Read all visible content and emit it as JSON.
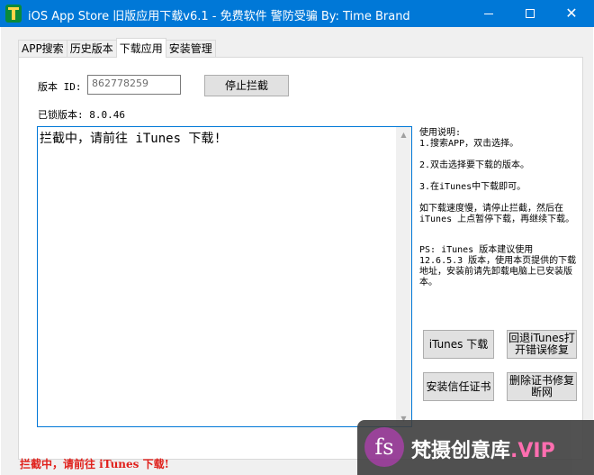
{
  "window": {
    "title": "iOS App Store 旧版应用下载v6.1 - 免费软件 警防受骗 By: Time Brand",
    "controls": {
      "minimize": "—",
      "maximize": "□",
      "close": "✕"
    }
  },
  "tabs": [
    {
      "label": "APP搜索",
      "active": false
    },
    {
      "label": "历史版本",
      "active": false
    },
    {
      "label": "下载应用",
      "active": true
    },
    {
      "label": "安装管理",
      "active": false
    }
  ],
  "download": {
    "version_label": "版本 ID:",
    "version_id_value": "862778259",
    "stop_button": "停止拦截",
    "locked_version": "已锁版本: 8.0.46",
    "log_text": "拦截中，请前往 iTunes 下载!"
  },
  "help": {
    "title": "使用说明:",
    "step1": "1.搜索APP，双击选择。",
    "step2": "2.双击选择要下载的版本。",
    "step3": "3.在iTunes中下载即可。",
    "tip": "如下载速度慢，请停止拦截，然后在 iTunes 上点暂停下载，再继续下载。",
    "ps": "PS: iTunes 版本建议使用 12.6.5.3 版本，使用本页提供的下载地址，安装前请先卸载电脑上已安装版本。"
  },
  "buttons": {
    "itunes_download": "iTunes 下载",
    "rollback_itunes": "回退iTunes打开错误修复",
    "install_cert": "安装信任证书",
    "delete_cert": "删除证书修复断网"
  },
  "status": {
    "text": "拦截中，请前往 iTunes 下载!",
    "color": "#e0201b"
  },
  "watermark": {
    "logo": "fs",
    "text_main": "梵摄创意库",
    "text_suffix": ".VIP"
  },
  "colors": {
    "titlebar": "#0078d7",
    "accent": "#0078d7"
  }
}
